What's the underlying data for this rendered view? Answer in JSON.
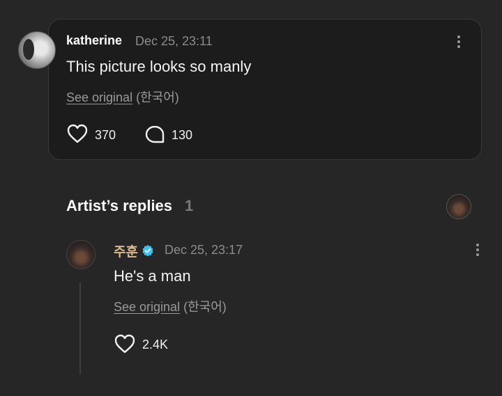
{
  "comment": {
    "username": "katherine",
    "timestamp": "Dec 25, 23:11",
    "text": "This picture looks so manly",
    "see_original_link": "See original",
    "see_original_lang": "(한국어)",
    "like_count": "370",
    "reply_count": "130"
  },
  "replies_section": {
    "title": "Artist’s replies",
    "count": "1"
  },
  "reply": {
    "username": "주훈",
    "timestamp": "Dec 25, 23:17",
    "text": "He's a man",
    "see_original_link": "See original",
    "see_original_lang": "(한국어)",
    "like_count": "2.4K",
    "verified_color": "#3fc2f0",
    "username_color": "#d9b88f"
  },
  "icons": {
    "like": "heart-icon",
    "comment": "speech-bubble-icon",
    "more": "more-vertical-icon",
    "verified": "verified-badge-icon"
  }
}
